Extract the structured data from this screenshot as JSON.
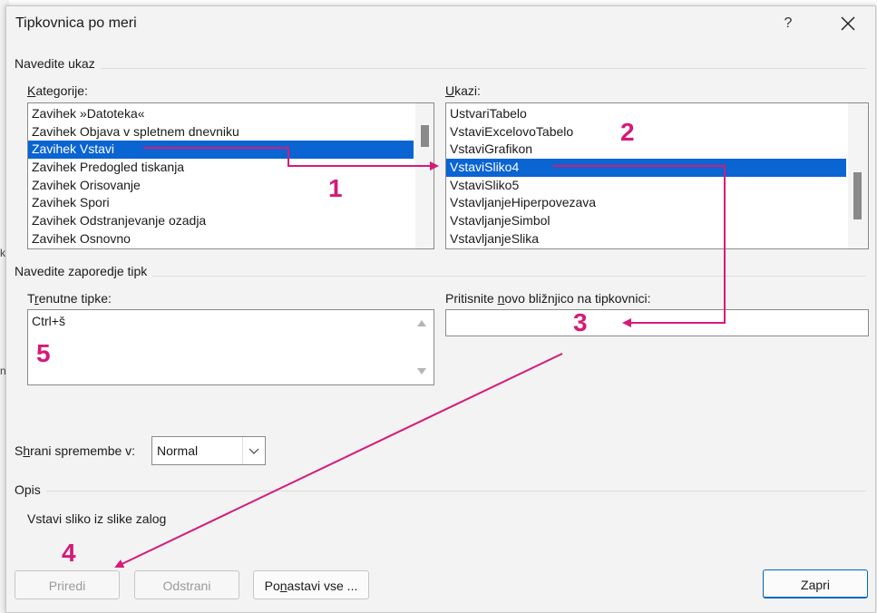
{
  "dialog": {
    "title": "Tipkovnica po meri",
    "help": "?"
  },
  "command_group": {
    "label": "Navedite ukaz",
    "categories_label_prefix": "",
    "categories_label_u": "K",
    "categories_label_rest": "ategorije:",
    "commands_label_u": "U",
    "commands_label_rest": "kazi:",
    "categories": [
      "Zavihek »Datoteka«",
      "Zavihek Objava v spletnem dnevniku",
      "Zavihek Vstavi",
      "Zavihek Predogled tiskanja",
      "Zavihek Orisovanje",
      "Zavihek Spori",
      "Zavihek Odstranjevanje ozadja",
      "Zavihek Osnovno"
    ],
    "categories_selected_index": 2,
    "commands": [
      "UstvariTabelo",
      "VstaviExcelovoTabelo",
      "VstaviGrafikon",
      "VstaviSliko4",
      "VstaviSliko5",
      "VstavljanjeHiperpovezava",
      "VstavljanjeSimbol",
      "VstavljanjeSlika"
    ],
    "commands_selected_index": 3
  },
  "keys_group": {
    "label": "Navedite zaporedje tipk",
    "current_label_a": "T",
    "current_label_u": "r",
    "current_label_rest": "enutne tipke:",
    "current_keys": [
      "Ctrl+š"
    ],
    "new_label_a": "Pritisnite ",
    "new_label_u": "n",
    "new_label_rest": "ovo bližnjico na tipkovnici:",
    "new_shortcut_value": ""
  },
  "save_in": {
    "label_a": "S",
    "label_u": "h",
    "label_rest": "rani spremembe v:",
    "value": "Normal"
  },
  "description": {
    "label": "Opis",
    "text": "Vstavi sliko iz slike zalog"
  },
  "buttons": {
    "assign": "Priredi",
    "remove": "Odstrani",
    "reset_a": "Po",
    "reset_u": "n",
    "reset_rest": "astavi vse ...",
    "close": "Zapri"
  },
  "annotations": {
    "color": "#d6197a",
    "step1": "1",
    "step2": "2",
    "step3": "3",
    "step4": "4",
    "step5": "5"
  },
  "background_marks": [
    "k",
    "n"
  ]
}
